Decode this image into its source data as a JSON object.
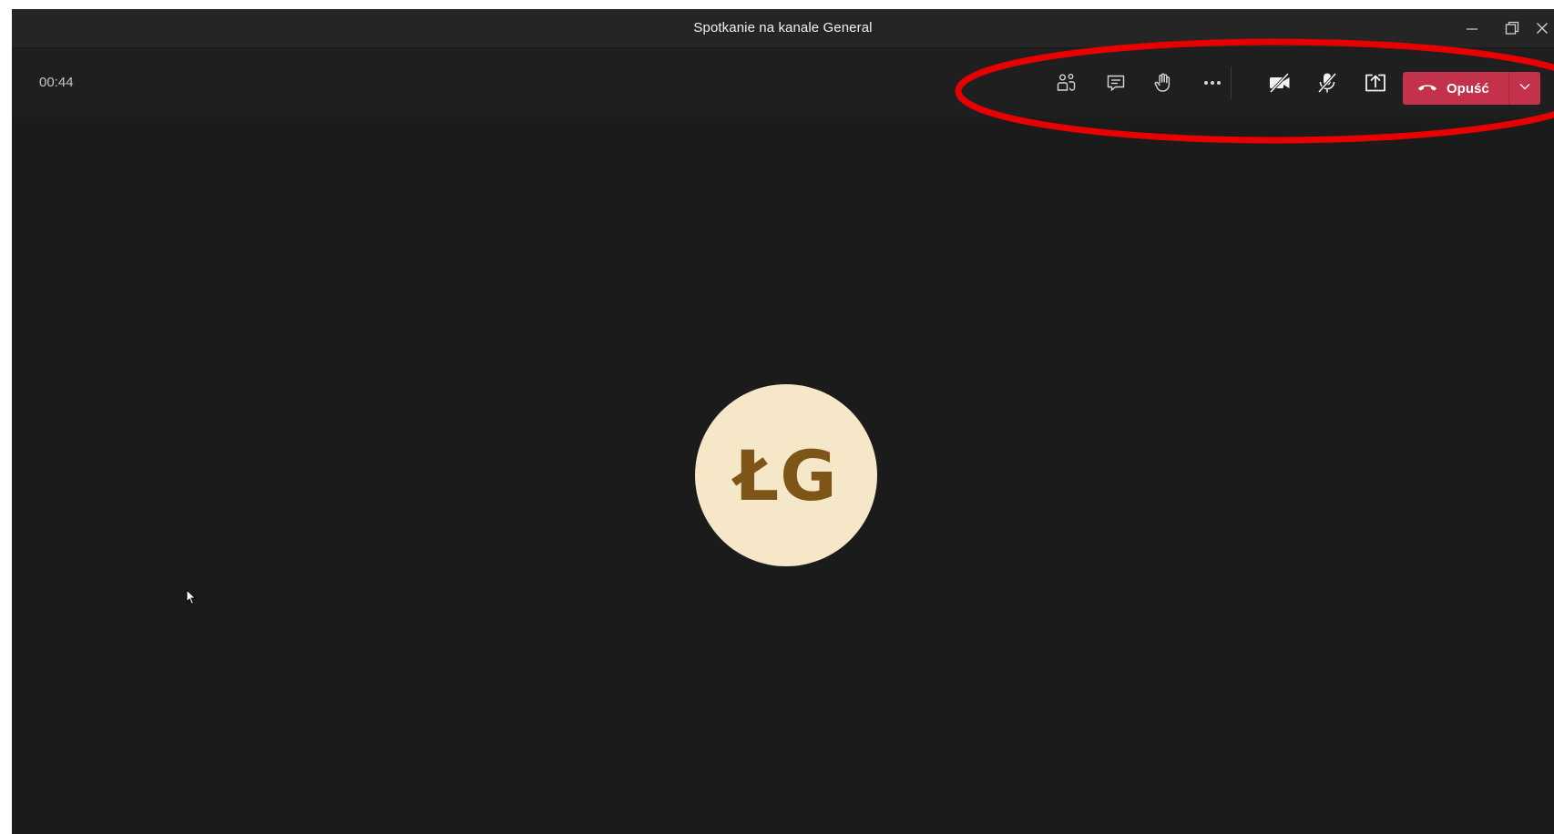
{
  "window": {
    "title": "Spotkanie na kanale General",
    "controls": [
      "minimize-icon",
      "restore-icon",
      "close-icon"
    ]
  },
  "toolbar": {
    "timer": "00:44",
    "buttons": [
      {
        "name": "participants",
        "icon": "people-icon"
      },
      {
        "name": "chat",
        "icon": "chat-icon"
      },
      {
        "name": "raise-hand",
        "icon": "hand-icon"
      },
      {
        "name": "more-actions",
        "icon": "more-icon"
      },
      {
        "name": "camera-off",
        "icon": "camera-off-icon"
      },
      {
        "name": "mic-muted",
        "icon": "mic-off-icon"
      },
      {
        "name": "share-screen",
        "icon": "share-tray-icon"
      }
    ],
    "leave_label": "Opuść"
  },
  "stage": {
    "avatar_initials": "ŁG"
  },
  "colors": {
    "background": "#1c1b1c",
    "toolbar": "#201f20",
    "titlebar": "#262526",
    "leave": "#c4314b",
    "avatar_bg": "#f6e7c8",
    "avatar_text": "#7d5617",
    "annotation": "#e60000"
  }
}
